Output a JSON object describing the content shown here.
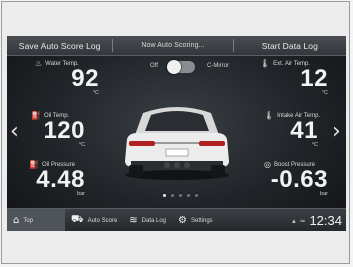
{
  "topbar": {
    "left_label": "Save Auto Score Log",
    "mid_label": "Now Auto Scoring...",
    "right_label": "Start Data Log"
  },
  "toggle": {
    "off_label": "Off",
    "on_label": "C-Mirror",
    "state": "off"
  },
  "gauges": {
    "water_temp": {
      "label": "Water Temp.",
      "value": "92",
      "unit": "°C",
      "icon": "water-temp-icon"
    },
    "oil_temp": {
      "label": "Oil Temp.",
      "value": "120",
      "unit": "°C",
      "icon": "oil-temp-icon"
    },
    "oil_pressure": {
      "label": "Oil Pressure",
      "value": "4.48",
      "unit": "bar",
      "icon": "oil-pressure-icon"
    },
    "ext_air_temp": {
      "label": "Ext. Air Temp.",
      "value": "12",
      "unit": "°C",
      "icon": "thermometer-icon"
    },
    "intake_air_temp": {
      "label": "Intake Air Temp.",
      "value": "41",
      "unit": "°C",
      "icon": "intake-air-icon"
    },
    "boost_pressure": {
      "label": "Boost Pressure",
      "value": "-0.63",
      "unit": "bar",
      "icon": "boost-pressure-icon"
    }
  },
  "pager": {
    "pages": 5,
    "current": 1
  },
  "bottombar": {
    "items": [
      {
        "label": "Top",
        "icon": "home-icon"
      },
      {
        "label": "Auto Score",
        "icon": "car-icon"
      },
      {
        "label": "Data Log",
        "icon": "data-log-icon"
      },
      {
        "label": "Settings",
        "icon": "gear-icon"
      }
    ],
    "clock": "12:34"
  },
  "colors": {
    "screen_bg": "#202428",
    "text": "#f2f2f2",
    "accent": "#4e545a"
  }
}
